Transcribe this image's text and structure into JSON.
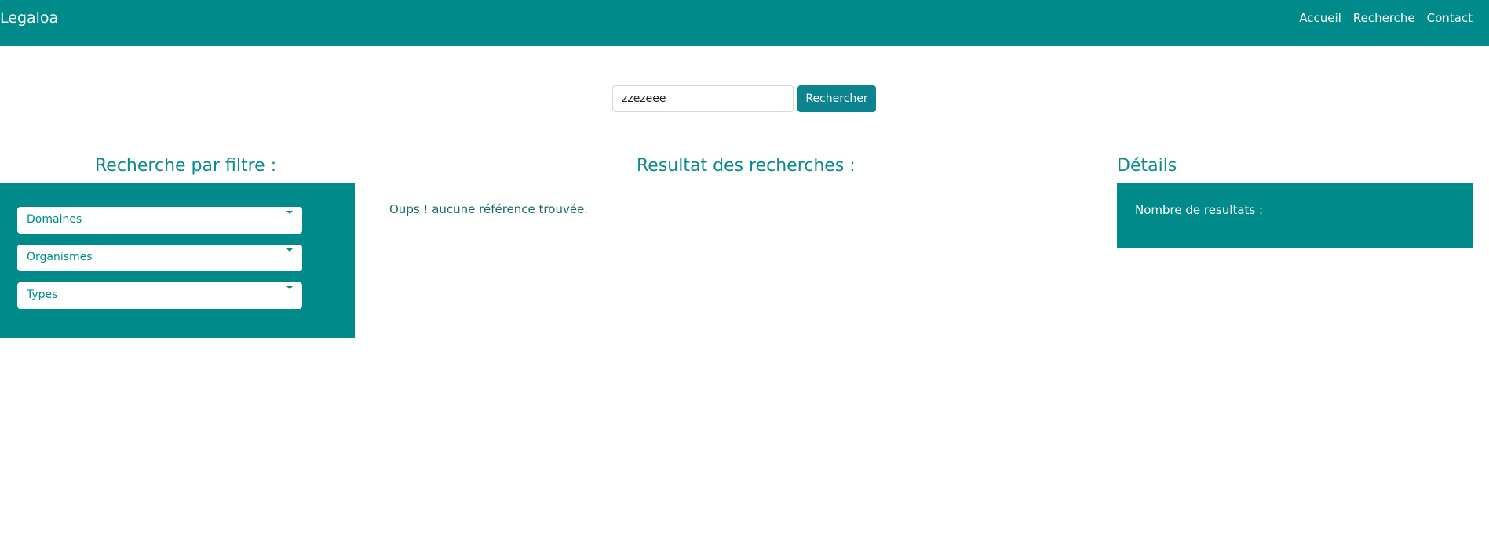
{
  "navbar": {
    "brand": "Legaloa",
    "links": [
      "Accueil",
      "Recherche",
      "Contact"
    ]
  },
  "search": {
    "value": "zzezeee",
    "button_label": "Rechercher"
  },
  "filters": {
    "title": "Recherche par filtre :",
    "dropdowns": [
      "Domaines",
      "Organismes",
      "Types"
    ]
  },
  "results": {
    "title": "Resultat des recherches :",
    "empty_message": "Oups ! aucune référence trouvée."
  },
  "details": {
    "title": "Détails",
    "count_label": "Nombre de resultats :"
  },
  "colors": {
    "primary": "#008b8b",
    "button": "#0b848f",
    "title_text": "#0b8a8a"
  }
}
